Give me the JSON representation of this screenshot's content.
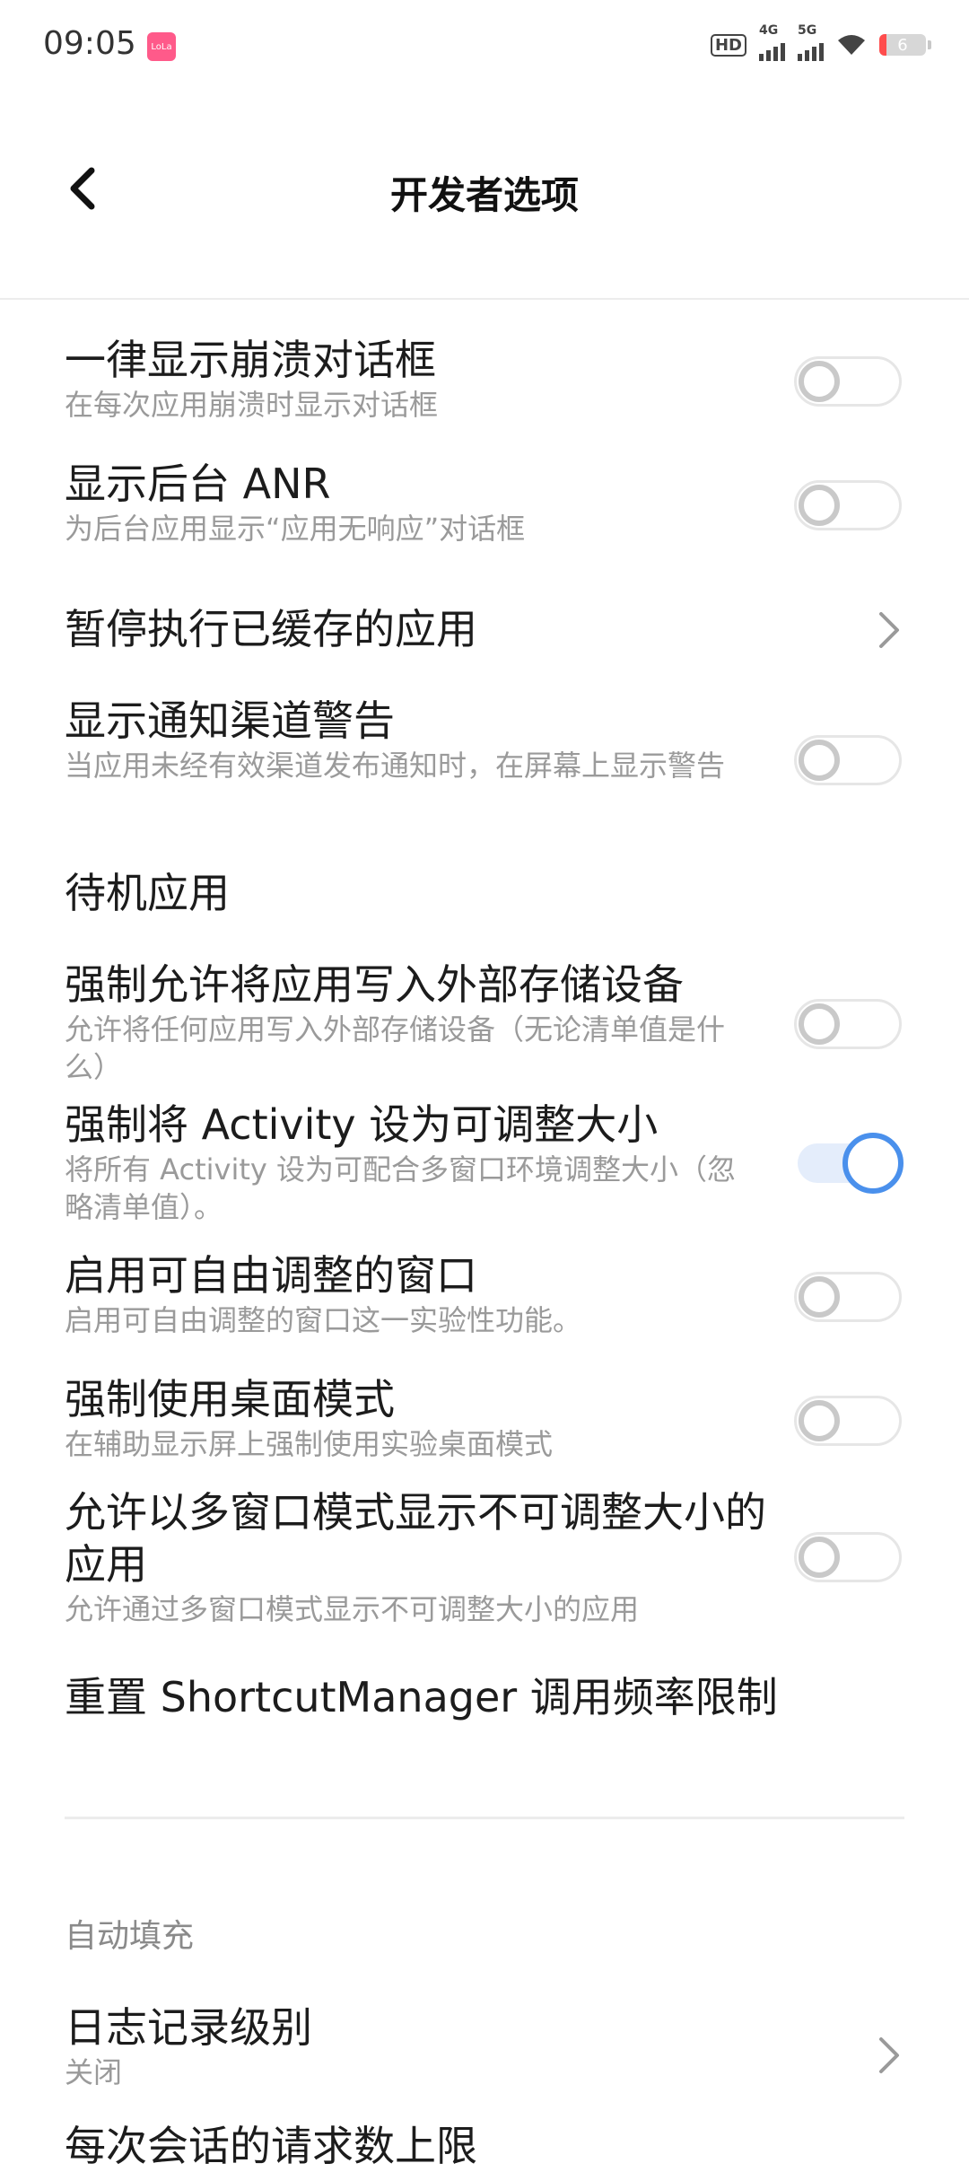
{
  "status_bar": {
    "time": "09:05",
    "app_icon_text": "LoLa",
    "hd_label": "HD",
    "sim1_label": "4G",
    "sim2_label": "5G",
    "battery_level": "6",
    "icons": [
      "hd-icon",
      "signal-4g-icon",
      "signal-5g-icon",
      "wifi-icon",
      "battery-icon"
    ]
  },
  "header": {
    "title": "开发者选项",
    "back_icon": "chevron-left-icon"
  },
  "items": [
    {
      "title": "一律显示崩溃对话框",
      "subtitle": "在每次应用崩溃时显示对话框",
      "control": "toggle",
      "on": false
    },
    {
      "title": "显示后台 ANR",
      "subtitle": "为后台应用显示“应用无响应”对话框",
      "control": "toggle",
      "on": false
    },
    {
      "title": "暂停执行已缓存的应用",
      "control": "chevron"
    },
    {
      "title": "显示通知渠道警告",
      "subtitle": "当应用未经有效渠道发布通知时，在屏幕上显示警告",
      "control": "toggle",
      "on": false
    },
    {
      "title": "待机应用",
      "control": "none"
    },
    {
      "title": "强制允许将应用写入外部存储设备",
      "subtitle": "允许将任何应用写入外部存储设备（无论清单值是什么）",
      "control": "toggle",
      "on": false
    },
    {
      "title": "强制将 Activity 设为可调整大小",
      "subtitle": "将所有 Activity 设为可配合多窗口环境调整大小（忽略清单值）。",
      "control": "toggle",
      "on": true
    },
    {
      "title": "启用可自由调整的窗口",
      "subtitle": "启用可自由调整的窗口这一实验性功能。",
      "control": "toggle",
      "on": false
    },
    {
      "title": "强制使用桌面模式",
      "subtitle": "在辅助显示屏上强制使用实验桌面模式",
      "control": "toggle",
      "on": false
    },
    {
      "title": "允许以多窗口模式显示不可调整大小的应用",
      "subtitle": "允许通过多窗口模式显示不可调整大小的应用",
      "control": "toggle",
      "on": false
    },
    {
      "title": "重置 ShortcutManager 调用频率限制",
      "control": "none"
    }
  ],
  "section_autofill": {
    "header": "自动填充",
    "items": [
      {
        "title": "日志记录级别",
        "subtitle": "关闭",
        "control": "chevron"
      },
      {
        "title": "每次会话的请求数上限",
        "control": "none"
      }
    ]
  },
  "colors": {
    "accent": "#4a90ec",
    "toggle_on_track": "#e4edfb",
    "toggle_off_knob": "#c9c9c9",
    "subtitle": "#9a9a9a"
  }
}
